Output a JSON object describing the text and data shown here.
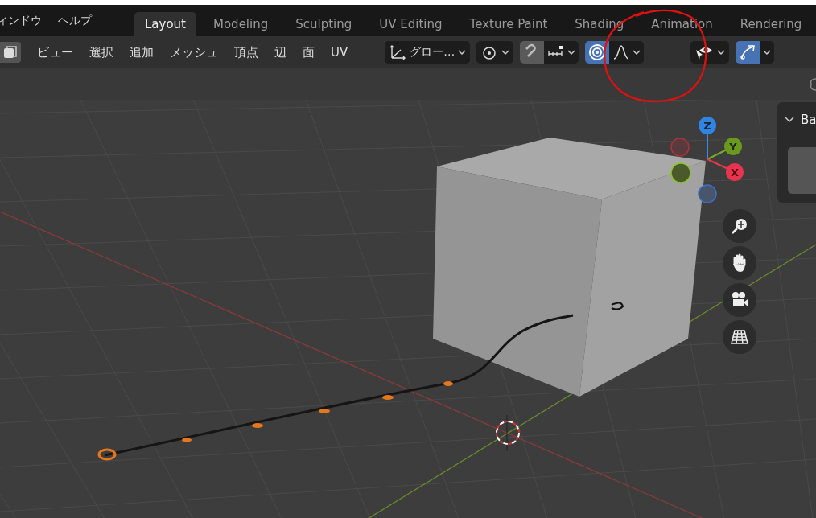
{
  "top_menus": [
    "ィンドウ",
    "ヘルプ"
  ],
  "workspace_tabs": [
    {
      "label": "Layout",
      "selected": true
    },
    {
      "label": "Modeling",
      "selected": false
    },
    {
      "label": "Sculpting",
      "selected": false
    },
    {
      "label": "UV Editing",
      "selected": false
    },
    {
      "label": "Texture Paint",
      "selected": false
    },
    {
      "label": "Shading",
      "selected": false
    },
    {
      "label": "Animation",
      "selected": false
    },
    {
      "label": "Rendering",
      "selected": false
    }
  ],
  "header_menus": [
    "ビュー",
    "選択",
    "追加",
    "メッシュ",
    "頂点",
    "辺",
    "面",
    "UV"
  ],
  "orientation": "グロー…",
  "toggles": {
    "snap": false,
    "proportional_editing": true,
    "gizmos": true
  },
  "gizmo_axes": [
    "Z",
    "Y",
    "X"
  ],
  "side_panel": {
    "title": "Ba"
  }
}
